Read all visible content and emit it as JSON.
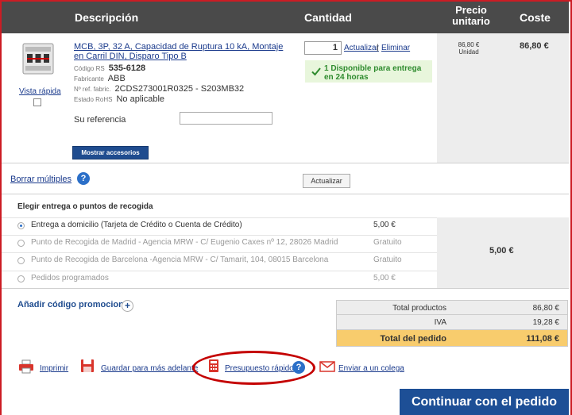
{
  "header": {
    "description": "Descripción",
    "quantity": "Cantidad",
    "unit_price": "Precio unitario",
    "cost": "Coste"
  },
  "product": {
    "title": "MCB, 3P, 32 A, Capacidad de Ruptura 10 kA, Montaje en Carril DIN, Disparo Tipo B",
    "quick_view": "Vista rápida",
    "rs_code_label": "Código RS",
    "rs_code": "535-6128",
    "manufacturer_label": "Fabricante",
    "manufacturer": "ABB",
    "mfr_ref_label": "Nº ref. fabric.",
    "mfr_ref": "2CDS273001R0325 - S203MB32",
    "rohs_label": "Estado RoHS",
    "rohs": "No aplicable",
    "your_ref_label": "Su referencia",
    "your_ref_value": "",
    "accessories_button": "Mostrar accesorios",
    "quantity": "1",
    "update_link": "Actualizar",
    "separator": "|",
    "remove_link": "Eliminar",
    "availability": "1 Disponible para entrega en 24 horas",
    "unit_price": "86,80 €",
    "unit_price_unit": "Unidad",
    "line_cost": "86,80 €"
  },
  "actions": {
    "delete_multiple": "Borrar múltiples",
    "help": "?",
    "update_button": "Actualizar"
  },
  "delivery": {
    "title": "Elegir entrega o puntos de recogida",
    "options": [
      {
        "label": "Entrega a domicilio (Tarjeta de Crédito o Cuenta de Crédito)",
        "price": "5,00 €",
        "selected": true
      },
      {
        "label": "Punto de Recogida de Madrid - Agencia MRW - C/ Eugenio Caxes nº 12, 28026 Madrid",
        "price": "Gratuito",
        "selected": false
      },
      {
        "label": "Punto de Recogida de Barcelona -Agencia MRW - C/ Tamarit, 104, 08015 Barcelona",
        "price": "Gratuito",
        "selected": false
      },
      {
        "label": "Pedidos programados",
        "price": "5,00 €",
        "selected": false
      }
    ],
    "total": "5,00 €"
  },
  "promo": {
    "label": "Añadir código promocional",
    "plus": "+"
  },
  "totals": {
    "products_label": "Total productos",
    "products_value": "86,80 €",
    "vat_label": "IVA",
    "vat_value": "19,28 €",
    "order_label": "Total del pedido",
    "order_value": "111,08 €"
  },
  "footer": {
    "print": "Imprimir",
    "save": "Guardar para más adelante",
    "quote": "Presupuesto rápido",
    "help": "?",
    "send": "Enviar a un colega",
    "continue": "Continuar con el pedido"
  },
  "colors": {
    "frame_border": "#cc1c24",
    "header_bg": "#4a4a4a",
    "link": "#1a3a8c",
    "button_blue": "#1d4f96",
    "total_highlight": "#f8cc6d",
    "availability_green": "#2e8b2e",
    "annotation_ellipse": "#c40000"
  },
  "icons": [
    "circuit-breaker-image",
    "check-icon",
    "help-icon",
    "plus-icon",
    "printer-icon",
    "floppy-disk-icon",
    "calculator-icon",
    "envelope-icon"
  ]
}
